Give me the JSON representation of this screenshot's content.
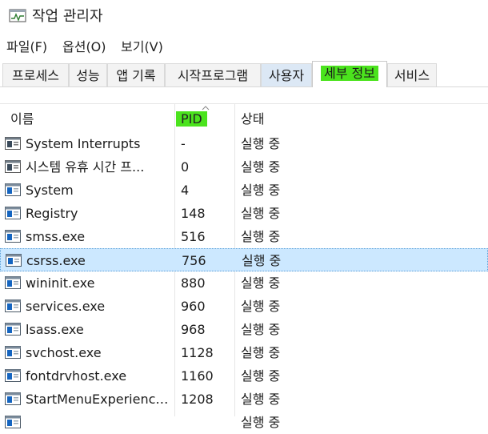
{
  "window": {
    "title": "작업 관리자"
  },
  "menu": [
    "파일(F)",
    "옵션(O)",
    "보기(V)"
  ],
  "tabs": [
    {
      "label": "프로세스",
      "state": "normal"
    },
    {
      "label": "성능",
      "state": "normal"
    },
    {
      "label": "앱 기록",
      "state": "normal"
    },
    {
      "label": "시작프로그램",
      "state": "normal"
    },
    {
      "label": "사용자",
      "state": "hover"
    },
    {
      "label": "세부 정보",
      "state": "active"
    },
    {
      "label": "서비스",
      "state": "normal"
    }
  ],
  "columns": {
    "name": "이름",
    "pid": "PID",
    "status": "상태"
  },
  "rows": [
    {
      "name": "System Interrupts",
      "pid": "-",
      "status": "실행 중",
      "icon": "system-process-icon"
    },
    {
      "name": "시스템 유휴 시간 프...",
      "pid": "0",
      "status": "실행 중",
      "icon": "system-process-icon"
    },
    {
      "name": "System",
      "pid": "4",
      "status": "실행 중",
      "icon": "window-process-icon"
    },
    {
      "name": "Registry",
      "pid": "148",
      "status": "실행 중",
      "icon": "window-process-icon"
    },
    {
      "name": "smss.exe",
      "pid": "516",
      "status": "실행 중",
      "icon": "window-process-icon"
    },
    {
      "name": "csrss.exe",
      "pid": "756",
      "status": "실행 중",
      "icon": "window-process-icon",
      "selected": true
    },
    {
      "name": "wininit.exe",
      "pid": "880",
      "status": "실행 중",
      "icon": "window-process-icon"
    },
    {
      "name": "services.exe",
      "pid": "960",
      "status": "실행 중",
      "icon": "window-process-icon"
    },
    {
      "name": "lsass.exe",
      "pid": "968",
      "status": "실행 중",
      "icon": "window-process-icon"
    },
    {
      "name": "svchost.exe",
      "pid": "1128",
      "status": "실행 중",
      "icon": "window-process-icon"
    },
    {
      "name": "fontdrvhost.exe",
      "pid": "1160",
      "status": "실행 중",
      "icon": "window-process-icon"
    },
    {
      "name": "StartMenuExperience...",
      "pid": "1208",
      "status": "실행 중",
      "icon": "window-process-icon"
    },
    {
      "name": "",
      "pid": "",
      "status": "실행 중",
      "icon": "window-process-icon"
    }
  ],
  "colors": {
    "highlight": "#4be31d",
    "selection": "#cce8ff",
    "icon_blue": "#1565c0"
  }
}
